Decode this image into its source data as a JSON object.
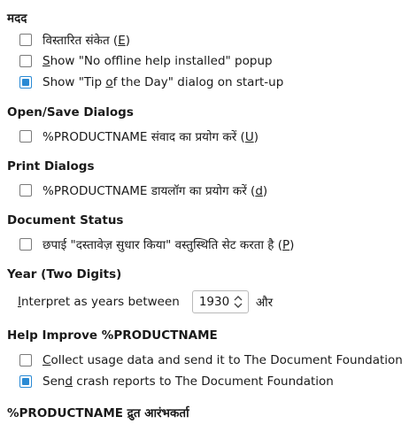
{
  "sections": {
    "help": {
      "title": "मदद",
      "options": [
        {
          "pre": "विस्तारित संकेत (",
          "key": "E",
          "post": ")",
          "checked": false
        },
        {
          "pre": "",
          "key": "S",
          "post": "how \"No offline help installed\" popup",
          "checked": false
        },
        {
          "pre": "Show \"Tip ",
          "key": "o",
          "post": "f the Day\" dialog on start-up",
          "checked": true
        }
      ]
    },
    "open_save": {
      "title": "Open/Save Dialogs",
      "options": [
        {
          "pre": "%PRODUCTNAME संवाद का प्रयोग करें (",
          "key": "U",
          "post": ")",
          "checked": false
        }
      ]
    },
    "print": {
      "title": "Print Dialogs",
      "options": [
        {
          "pre": "%PRODUCTNAME डायलॉग का प्रयोग करें (",
          "key": "d",
          "post": ")",
          "checked": false
        }
      ]
    },
    "doc_status": {
      "title": "Document Status",
      "options": [
        {
          "pre": "छपाई \"दस्तावेज़ सुधार किया\" वस्तुस्थिति सेट करता है (",
          "key": "P",
          "post": ")",
          "checked": false
        }
      ]
    },
    "year": {
      "title": "Year (Two Digits)",
      "label_key": "I",
      "label_rest": "nterpret as years between",
      "value": "1930",
      "suffix": "और"
    },
    "improve": {
      "title": "Help Improve %PRODUCTNAME",
      "options": [
        {
          "pre": "",
          "key": "C",
          "post": "ollect usage data and send it to The Document Foundation",
          "checked": false
        },
        {
          "pre": "Sen",
          "key": "d",
          "post": " crash reports to The Document Foundation",
          "checked": true
        }
      ]
    },
    "quickstarter": {
      "title": "%PRODUCTNAME द्रुत आरंभकर्ता"
    }
  },
  "colors": {
    "accent": "#2a8ad4"
  }
}
